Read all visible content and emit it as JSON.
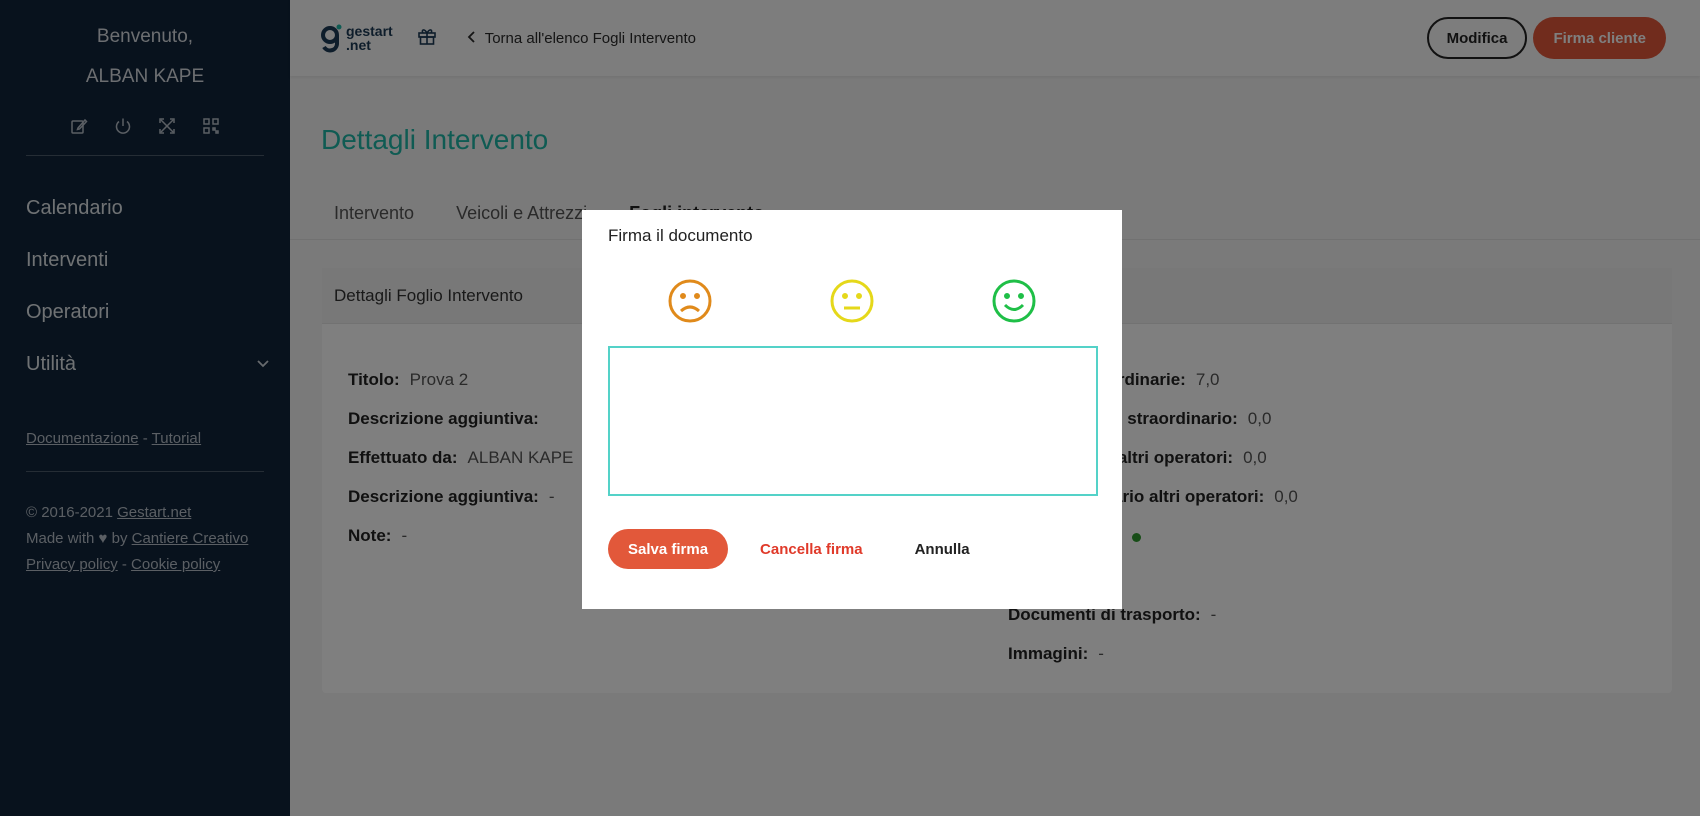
{
  "sidebar": {
    "welcome": "Benvenuto,",
    "user": "ALBAN KAPE",
    "icons": [
      "edit-icon",
      "power-icon",
      "fullscreen-icon",
      "qr-code-icon"
    ],
    "nav": [
      {
        "label": "Calendario"
      },
      {
        "label": "Interventi"
      },
      {
        "label": "Operatori"
      },
      {
        "label": "Utilità"
      }
    ],
    "links": {
      "doc": "Documentazione",
      "sep": " - ",
      "tutorial": "Tutorial"
    },
    "footer": {
      "copyright": "© 2016-2021 ",
      "brand_link": "Gestart.net",
      "made_with": "Made with ♥ by ",
      "creator": "Cantiere Creativo",
      "privacy": "Privacy policy",
      "sep": " - ",
      "cookie": "Cookie policy"
    }
  },
  "topbar": {
    "logo_line1": "gestart",
    "logo_line2": ".net",
    "back_label": "Torna all'elenco Fogli Intervento",
    "edit_button": "Modifica",
    "sign_button": "Firma cliente"
  },
  "main": {
    "title": "Dettagli Intervento",
    "tabs": [
      "Intervento",
      "Veicoli e Attrezzi",
      "Fogli intervento"
    ],
    "card_title": "Dettagli Foglio Intervento",
    "left_fields": [
      {
        "label": "Titolo:",
        "value": "Prova 2"
      },
      {
        "label": "Descrizione aggiuntiva:",
        "value": ""
      },
      {
        "label": "Effettuato da:",
        "value": "ALBAN KAPE"
      },
      {
        "label": "Descrizione aggiuntiva:",
        "value": "-"
      },
      {
        "label": "Note:",
        "value": "-"
      }
    ],
    "right_fields": [
      {
        "label": "i ordinarie:",
        "value": "7,0"
      },
      {
        "label": "i di straordinario:",
        "value": "0,0"
      },
      {
        "label": "di altri operatori:",
        "value": "0,0"
      },
      {
        "label": "inario altri operatori:",
        "value": "0,0"
      },
      {
        "label": "Documenti di trasporto:",
        "value": "-"
      },
      {
        "label": "Immagini:",
        "value": "-"
      }
    ]
  },
  "modal": {
    "title": "Firma il documento",
    "ratings": [
      "sad-face-icon",
      "neutral-face-icon",
      "happy-face-icon"
    ],
    "save_button": "Salva firma",
    "clear_button": "Cancella firma",
    "cancel_button": "Annulla"
  },
  "colors": {
    "sidebar": "#10243a",
    "accent_orange": "#e2583a",
    "title_teal": "#1fb7a6",
    "sad": "#e08a1b",
    "neutral": "#e5d81a",
    "happy": "#1fbf47"
  }
}
